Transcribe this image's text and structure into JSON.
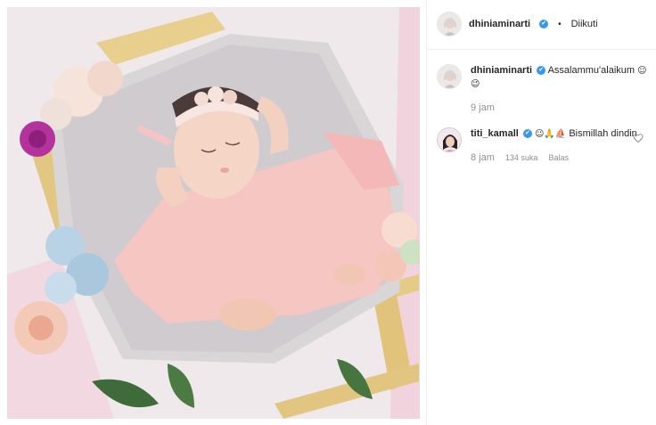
{
  "post": {
    "author": "dhiniaminarti",
    "follow_state": "Diikuti",
    "separator": "•",
    "verified_mark": "✔"
  },
  "comments": [
    {
      "username": "dhiniaminarti",
      "text": "Assalammu'alaikum",
      "emoji": "☺😉",
      "time": "9 jam"
    },
    {
      "username": "titi_kamall",
      "text": "Bismillah dindin",
      "emoji": "☺🙏⛵",
      "time": "8 jam",
      "likes": "134 suka",
      "reply": "Balas"
    }
  ],
  "icons": {
    "like": "heart-outline-icon"
  },
  "colors": {
    "verified": "#3897f0",
    "meta_gray": "#8e8e8e",
    "text": "#262626"
  }
}
